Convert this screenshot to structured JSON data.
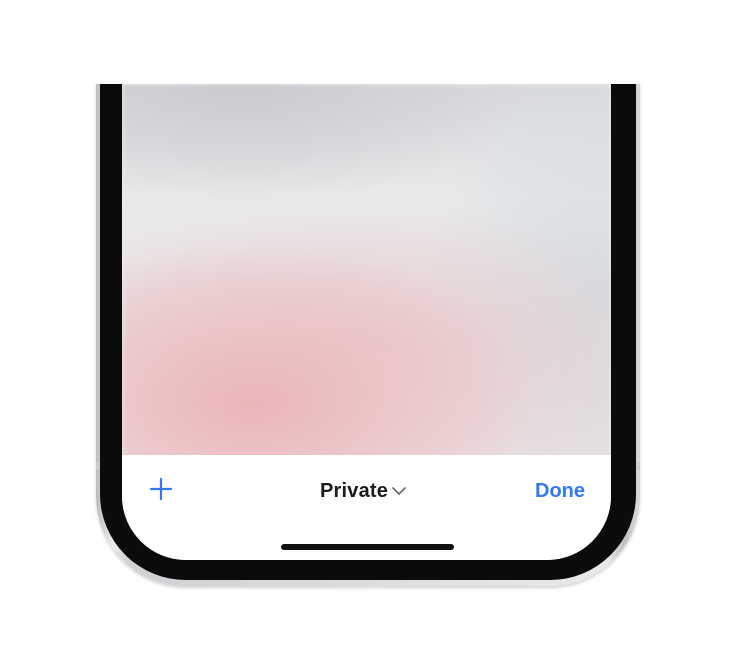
{
  "toolbar": {
    "add_icon": "plus-icon",
    "tab_group_label": "Private",
    "tab_group_chevron_icon": "chevron-down-icon",
    "done_label": "Done"
  },
  "colors": {
    "accent": "#3478f6",
    "label": "#1c1c1e",
    "toolbar_background": "#ffffff",
    "bezel": "#0b0b0b"
  }
}
